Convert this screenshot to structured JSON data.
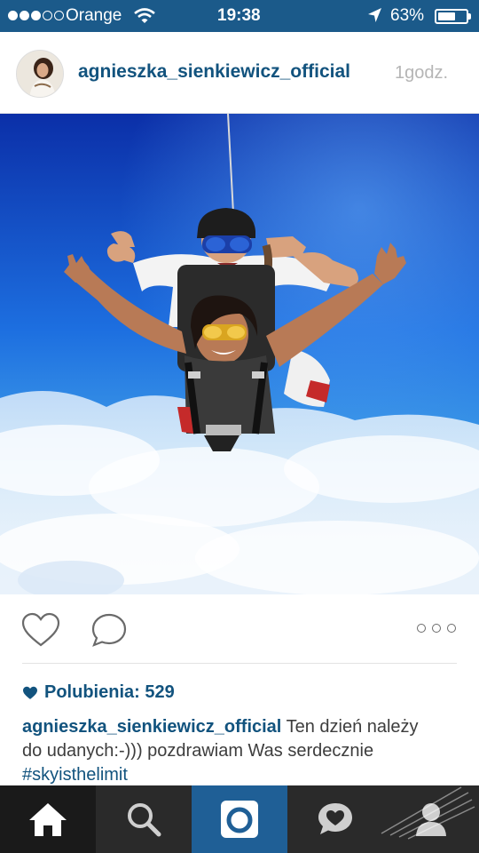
{
  "status_bar": {
    "carrier": "Orange",
    "time": "19:38",
    "battery_percent": "63%",
    "battery_level": 0.63,
    "signal_bars": 3,
    "signal_total": 5
  },
  "post": {
    "username": "agnieszka_sienkiewicz_official",
    "time_ago": "1godz."
  },
  "likes": {
    "label": "Polubienia: 529"
  },
  "caption": {
    "username": "agnieszka_sienkiewicz_official",
    "text": " Ten dzień należy do udanych:-))) pozdrawiam Was serdecznie ",
    "hashtag": "#skyisthelimit"
  },
  "tabs": [
    "home-icon",
    "search-icon",
    "camera-icon",
    "activity-icon",
    "profile-icon"
  ],
  "colors": {
    "brand": "#12537e",
    "status_bar": "#1b5a8a",
    "tab_active": "#1f5f96"
  }
}
